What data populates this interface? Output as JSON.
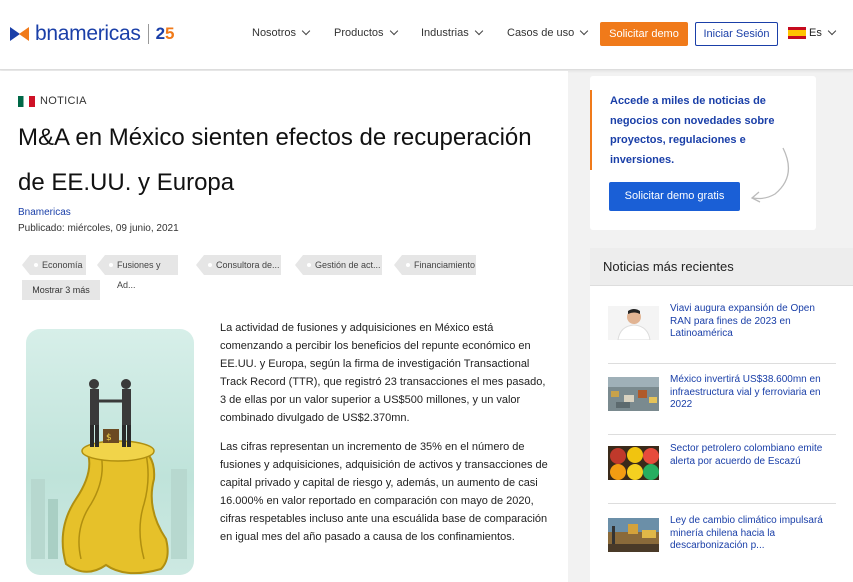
{
  "header": {
    "logo_text": "bnamericas",
    "logo_anniv_main": "2",
    "logo_anniv_accent": "5",
    "nav": [
      "Nosotros",
      "Productos",
      "Industrias",
      "Casos de uso"
    ],
    "demo_button": "Solicitar demo",
    "login_button": "Iniciar Sesión",
    "language": "Es",
    "colors": {
      "brand_blue": "#1a3fa8",
      "brand_orange": "#f07a1a"
    }
  },
  "article": {
    "category": "NOTICIA",
    "title": "M&A en México sienten efectos de recuperación de EE.UU. y Europa",
    "author": "Bnamericas",
    "published": "Publicado: miércoles, 09 junio, 2021",
    "tags": [
      "Economía",
      "Fusiones y Ad...",
      "Consultora de...",
      "Gestión de act...",
      "Financiamiento"
    ],
    "show_more": "Mostrar 3 más",
    "paragraphs": [
      "La actividad de fusiones y adquisiciones en México está comenzando a percibir los beneficios del repunte económico en EE.UU. y Europa, según la firma de investigación Transactional Track Record (TTR), que registró 23 transacciones el mes pasado, 3 de ellas por un valor superior a US$500 millones, y un valor combinado divulgado de US$2.370mn.",
      "Las cifras representan un incremento de 35% en el número de fusiones y adquisiciones, adquisición de activos y transacciones de capital privado y capital de riesgo y, además, un aumento de casi 16.000% en valor reportado en comparación con mayo de 2020, cifras respetables incluso ante una escuálida base de comparación en igual mes del año pasado a causa de los confinamientos."
    ]
  },
  "sidebar": {
    "promo_text": "Accede a miles de noticias de negocios con novedades sobre proyectos, regulaciones e inversiones.",
    "promo_button": "Solicitar demo gratis",
    "recent_title": "Noticias más recientes",
    "recent": [
      {
        "title": "Viavi augura expansión de Open RAN para fines de 2023 en Latinoamérica"
      },
      {
        "title": "México invertirá US$38.600mn en infraestructura vial y ferroviaria en 2022"
      },
      {
        "title": "Sector petrolero colombiano emite alerta por acuerdo de Escazú"
      },
      {
        "title": "Ley de cambio climático impulsará minería chilena hacia la descarbonización p..."
      }
    ]
  }
}
